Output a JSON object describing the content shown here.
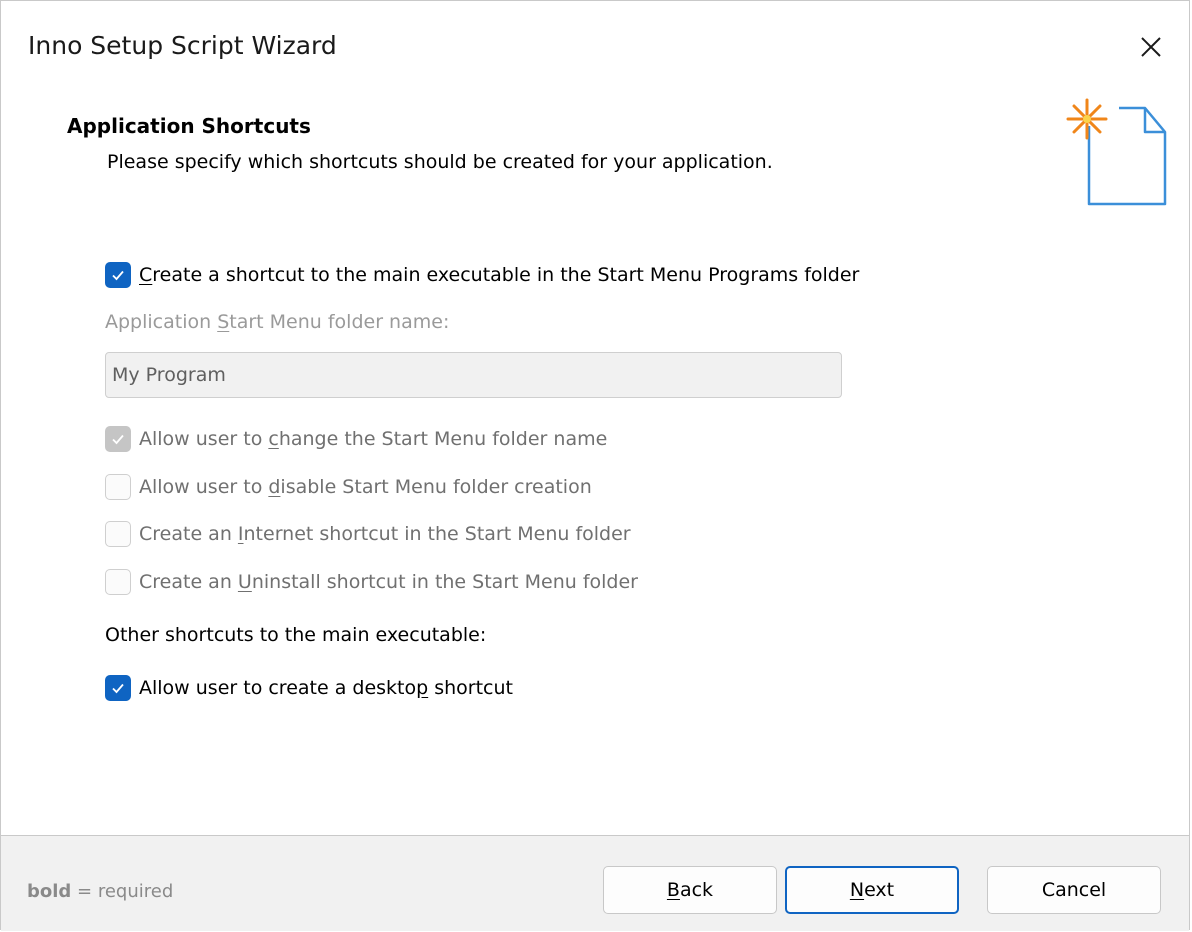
{
  "window": {
    "title": "Inno Setup Script Wizard"
  },
  "header": {
    "title": "Application Shortcuts",
    "description": "Please specify which shortcuts should be created for your application."
  },
  "options": {
    "create_start_menu": {
      "pre": "",
      "u": "C",
      "post": "reate a shortcut to the main executable in the Start Menu Programs folder",
      "checked": true,
      "enabled": true
    },
    "folder_label": {
      "pre": "Application ",
      "u": "S",
      "post": "tart Menu folder name:"
    },
    "folder_name_value": "My Program",
    "allow_change": {
      "pre": "Allow user to ",
      "u": "c",
      "post": "hange the Start Menu folder name",
      "checked": true,
      "enabled": false
    },
    "allow_disable": {
      "pre": "Allow user to ",
      "u": "d",
      "post": "isable Start Menu folder creation",
      "checked": false,
      "enabled": false
    },
    "internet_shortcut": {
      "pre": "Create an ",
      "u": "I",
      "post": "nternet shortcut in the Start Menu folder",
      "checked": false,
      "enabled": false
    },
    "uninstall_shortcut": {
      "pre": "Create an ",
      "u": "U",
      "post": "ninstall shortcut in the Start Menu folder",
      "checked": false,
      "enabled": false
    },
    "other_label": "Other shortcuts to the main executable:",
    "desktop_shortcut": {
      "pre": "Allow user to create a deskto",
      "u": "p",
      "post": " shortcut",
      "checked": true,
      "enabled": true
    }
  },
  "footer": {
    "note_bold": "bold",
    "note_rest": " = required",
    "back": {
      "u": "B",
      "post": "ack"
    },
    "next": {
      "u": "N",
      "post": "ext"
    },
    "cancel": "Cancel"
  },
  "colors": {
    "accent": "#0f64c2",
    "footer_bg": "#f1f1f1",
    "icon_orange": "#f0861a",
    "icon_blue": "#3b8fd9"
  },
  "icons": {
    "close": "close-icon",
    "wizard": "new-document-sparkle-icon",
    "check": "checkmark-icon"
  }
}
